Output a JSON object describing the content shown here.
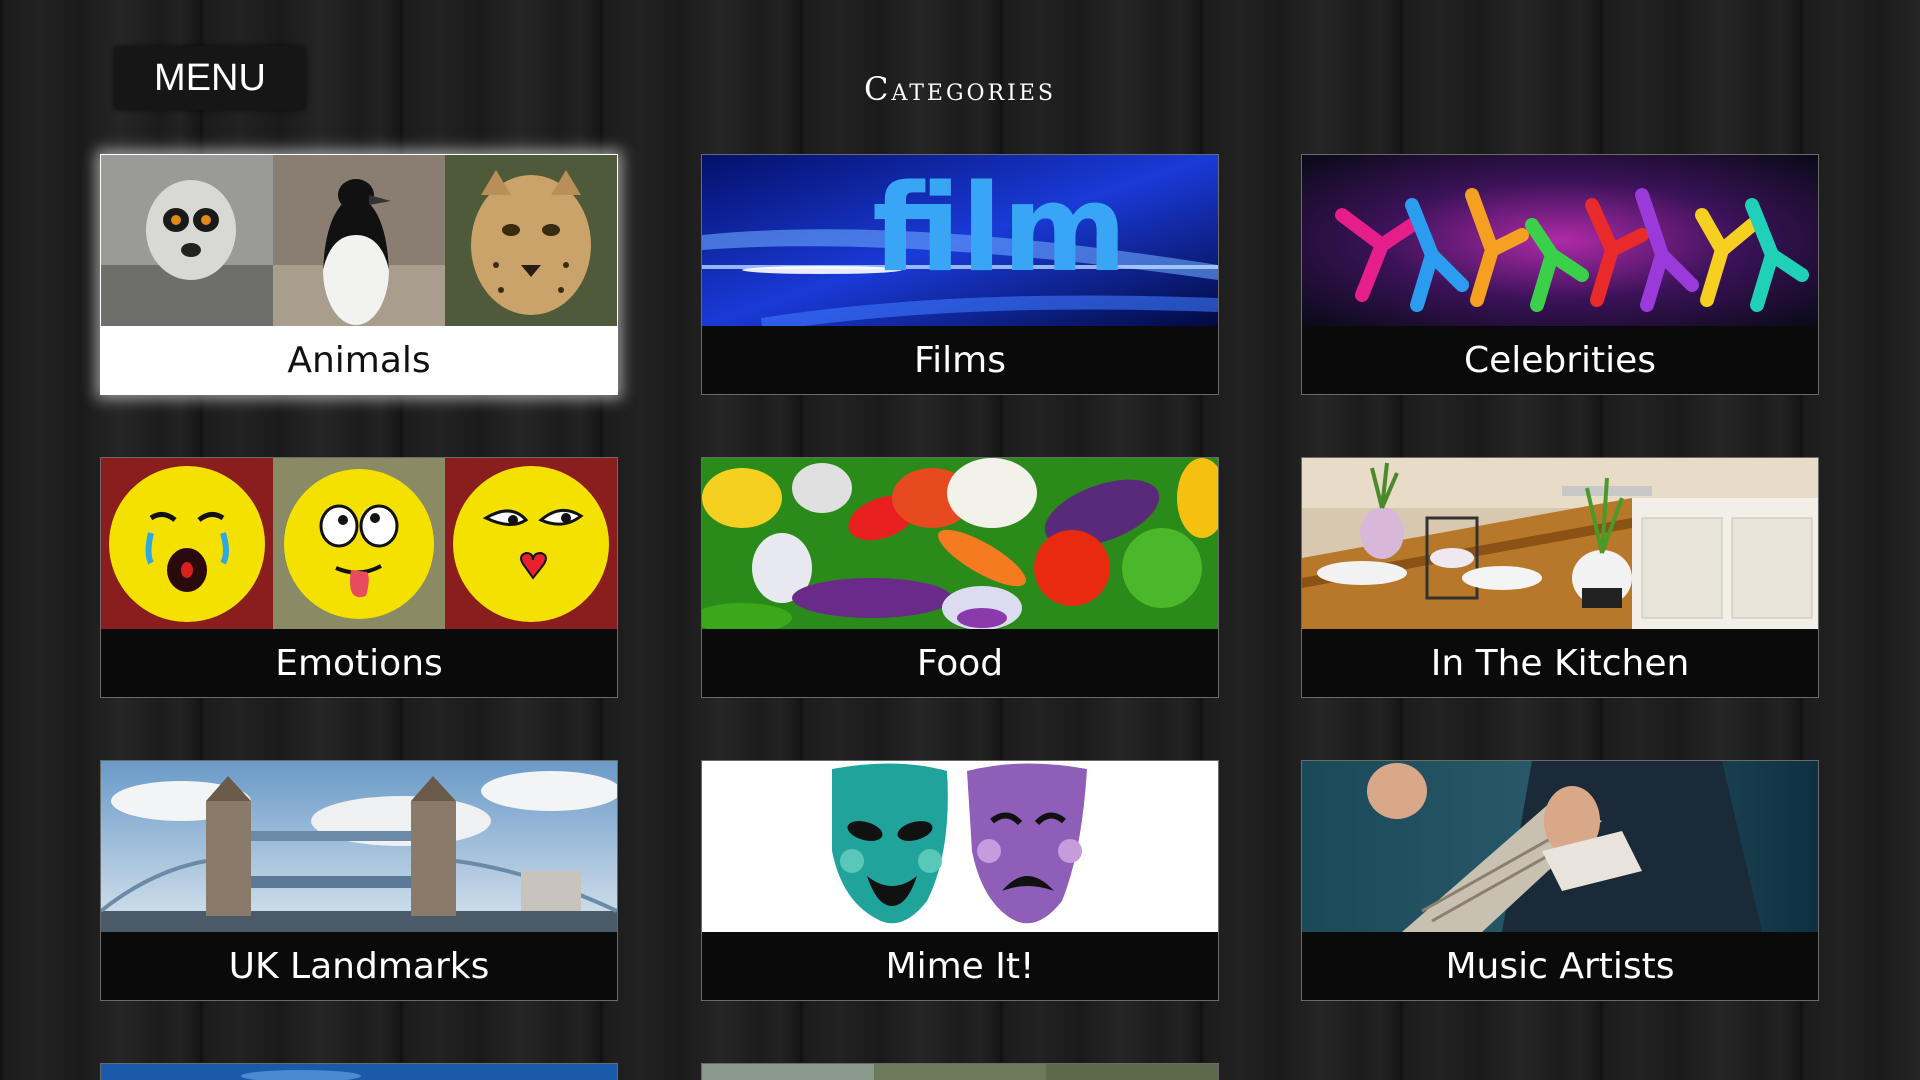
{
  "header": {
    "menu_label": "MENU",
    "title": "Categories"
  },
  "categories": [
    {
      "label": "Animals",
      "selected": true
    },
    {
      "label": "Films"
    },
    {
      "label": "Celebrities"
    },
    {
      "label": "Emotions"
    },
    {
      "label": "Food"
    },
    {
      "label": "In The Kitchen"
    },
    {
      "label": "UK Landmarks"
    },
    {
      "label": "Mime It!"
    },
    {
      "label": "Music Artists"
    }
  ],
  "thumbnail_text": {
    "films": "film"
  },
  "colors": {
    "background": "#1c1c1c",
    "label_bg": "#0a0a0a",
    "selected_label_bg": "#ffffff",
    "mask_teal": "#1fa39a",
    "mask_purple": "#8f5eb8",
    "emoji_yellow": "#f5e100"
  }
}
